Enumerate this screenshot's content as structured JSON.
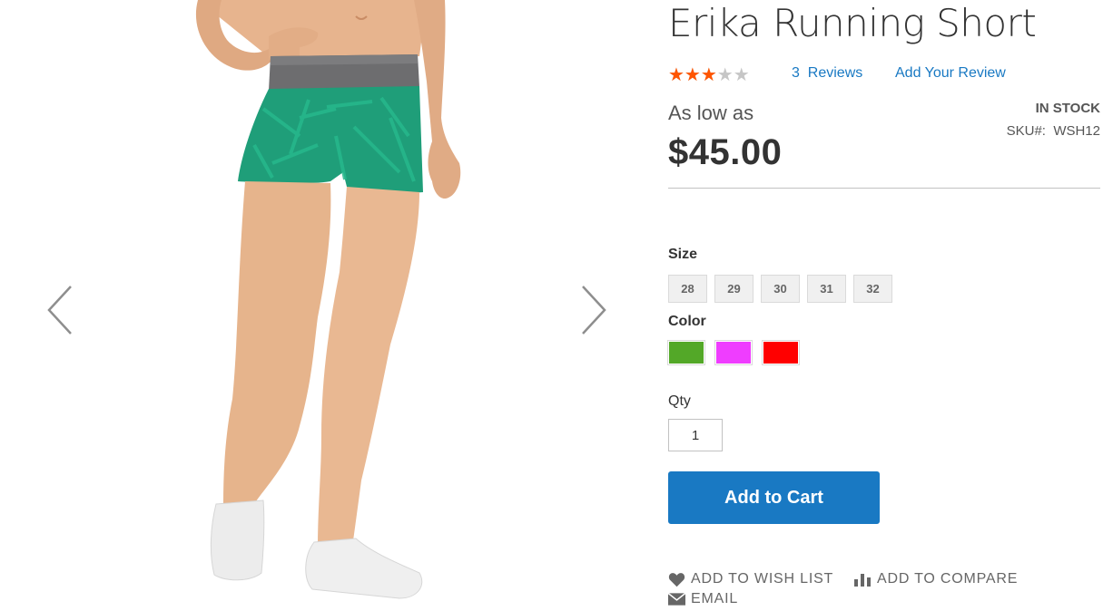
{
  "gallery": {
    "image_alt": "Erika Running Short worn by model",
    "prev_icon": "chevron-left-icon",
    "next_icon": "chevron-right-icon"
  },
  "product": {
    "title": "Erika Running Short",
    "rating": {
      "stars_filled": 3,
      "stars_total": 5,
      "reviews_count": "3",
      "reviews_label": "Reviews",
      "add_review_label": "Add Your Review"
    },
    "price_prefix": "As low as",
    "price": "$45.00",
    "stock_status": "IN STOCK",
    "sku_label": "SKU#:",
    "sku_value": "WSH12"
  },
  "options": {
    "size_label": "Size",
    "sizes": [
      "28",
      "29",
      "30",
      "31",
      "32"
    ],
    "color_label": "Color",
    "colors": [
      {
        "name": "Green",
        "hex": "#53a828"
      },
      {
        "name": "Purple",
        "hex": "#ef3dff"
      },
      {
        "name": "Red",
        "hex": "#ff0000"
      }
    ]
  },
  "cart": {
    "qty_label": "Qty",
    "qty_value": "1",
    "add_to_cart_label": "Add to Cart"
  },
  "actions": {
    "wish_list_label": "ADD TO WISH LIST",
    "compare_label": "ADD TO COMPARE",
    "email_label": "EMAIL"
  },
  "theme": {
    "accent": "#1979c3",
    "star_color": "#ff5501",
    "star_empty": "#c6c6c6"
  }
}
